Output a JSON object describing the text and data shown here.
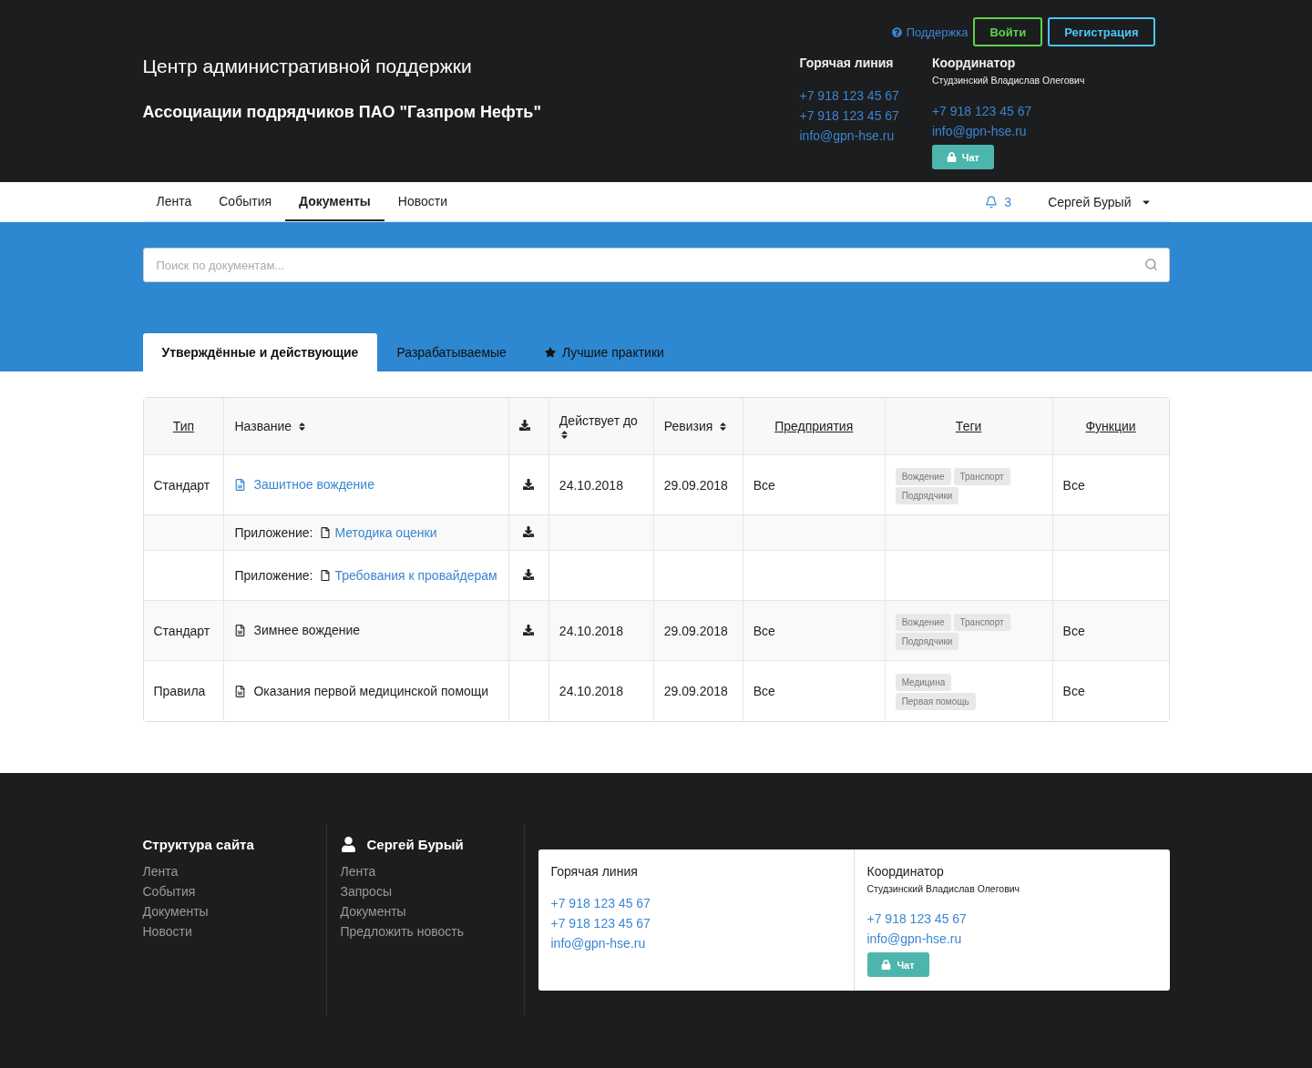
{
  "header": {
    "title": "Центр административной поддержки",
    "subtitle": "Ассоциации подрядчиков ПАО \"Газпром Нефть\"",
    "support_link": "Поддержка",
    "login_button": "Войти",
    "register_button": "Регистрация",
    "hotline": {
      "title": "Горячая линия",
      "phones": [
        "+7 918 123 45 67",
        "+7 918 123 45 67"
      ],
      "email": "info@gpn-hse.ru"
    },
    "coordinator": {
      "title": "Координатор",
      "name": "Студзинский Владислав Олегович",
      "phones": [
        "+7 918 123 45 67"
      ],
      "email": "info@gpn-hse.ru",
      "chat_button": "Чат"
    }
  },
  "nav": {
    "items": [
      {
        "label": "Лента",
        "selected": false
      },
      {
        "label": "События",
        "selected": false
      },
      {
        "label": "Документы",
        "selected": true
      },
      {
        "label": "Новости",
        "selected": false
      }
    ],
    "notifications": "3",
    "user": "Сергей Бурый"
  },
  "search": {
    "placeholder": "Поиск по документам..."
  },
  "tabs": [
    {
      "label": "Утверждённые и действующие",
      "selected": true,
      "kind": "plain"
    },
    {
      "label": "Разрабатываемые",
      "selected": false,
      "kind": "plain"
    },
    {
      "label": "Лучшие практики",
      "selected": false,
      "kind": "starred"
    }
  ],
  "table": {
    "columns": [
      {
        "kind": "link",
        "label": "Тип"
      },
      {
        "kind": "sort",
        "label": "Название"
      },
      {
        "kind": "download"
      },
      {
        "kind": "sort",
        "label": "Действует до"
      },
      {
        "kind": "sort",
        "label": "Ревизия"
      },
      {
        "kind": "link",
        "label": "Предприятия"
      },
      {
        "kind": "link",
        "label": "Теги"
      },
      {
        "kind": "link",
        "label": "Функции"
      }
    ],
    "rows": [
      {
        "kind": "document",
        "type": "Стандарт",
        "name": "Зашитное вождение",
        "link": true,
        "downloadable": true,
        "valid_until": "24.10.2018",
        "revision": "29.09.2018",
        "companies": "Все",
        "tags": [
          "Вождение",
          "Транспорт",
          "Подрядчики"
        ],
        "functions": "Все"
      },
      {
        "kind": "attachment",
        "prefix": "Приложение:",
        "name": "Методика оценки",
        "link": true,
        "downloadable": true
      },
      {
        "kind": "attachment",
        "prefix": "Приложение:",
        "name": "Требования к провайдерам",
        "link": true,
        "downloadable": true
      },
      {
        "kind": "document",
        "type": "Стандарт",
        "name": "Зимнее вождение",
        "link": false,
        "downloadable": true,
        "valid_until": "24.10.2018",
        "revision": "29.09.2018",
        "companies": "Все",
        "tags": [
          "Вождение",
          "Транспорт",
          "Подрядчики"
        ],
        "functions": "Все"
      },
      {
        "kind": "document",
        "type": "Правила",
        "name": "Оказания первой медицинской помощи",
        "link": false,
        "downloadable": false,
        "valid_until": "24.10.2018",
        "revision": "29.09.2018",
        "companies": "Все",
        "tags": [
          "Медицина",
          "Первая помощь"
        ],
        "functions": "Все"
      }
    ]
  },
  "footer": {
    "site_map": {
      "title": "Структура сайта",
      "items": [
        "Лента",
        "События",
        "Документы",
        "Новости"
      ]
    },
    "user": {
      "name": "Сергей Бурый",
      "items": [
        "Лента",
        "Запросы",
        "Документы",
        "Предложить новость"
      ]
    },
    "hotline": {
      "title": "Горячая линия",
      "phones": [
        "+7 918 123 45 67",
        "+7 918 123 45 67"
      ],
      "email": "info@gpn-hse.ru"
    },
    "coordinator": {
      "title": "Координатор",
      "name": "Студзинский Владислав Олегович",
      "phones": [
        "+7 918 123 45 67"
      ],
      "email": "info@gpn-hse.ru",
      "chat_button": "Чат"
    }
  }
}
